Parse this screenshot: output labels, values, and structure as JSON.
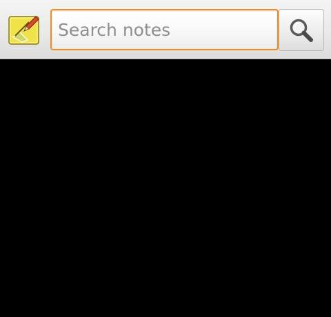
{
  "search": {
    "placeholder": "Search notes",
    "value": ""
  },
  "icons": {
    "app": "notes-app-icon",
    "search": "magnifier-icon"
  },
  "colors": {
    "focus_border": "#f28c1e",
    "toolbar_background": "#e9e9e9",
    "content_background": "#000000",
    "note_icon_yellow": "#f2e24a"
  }
}
